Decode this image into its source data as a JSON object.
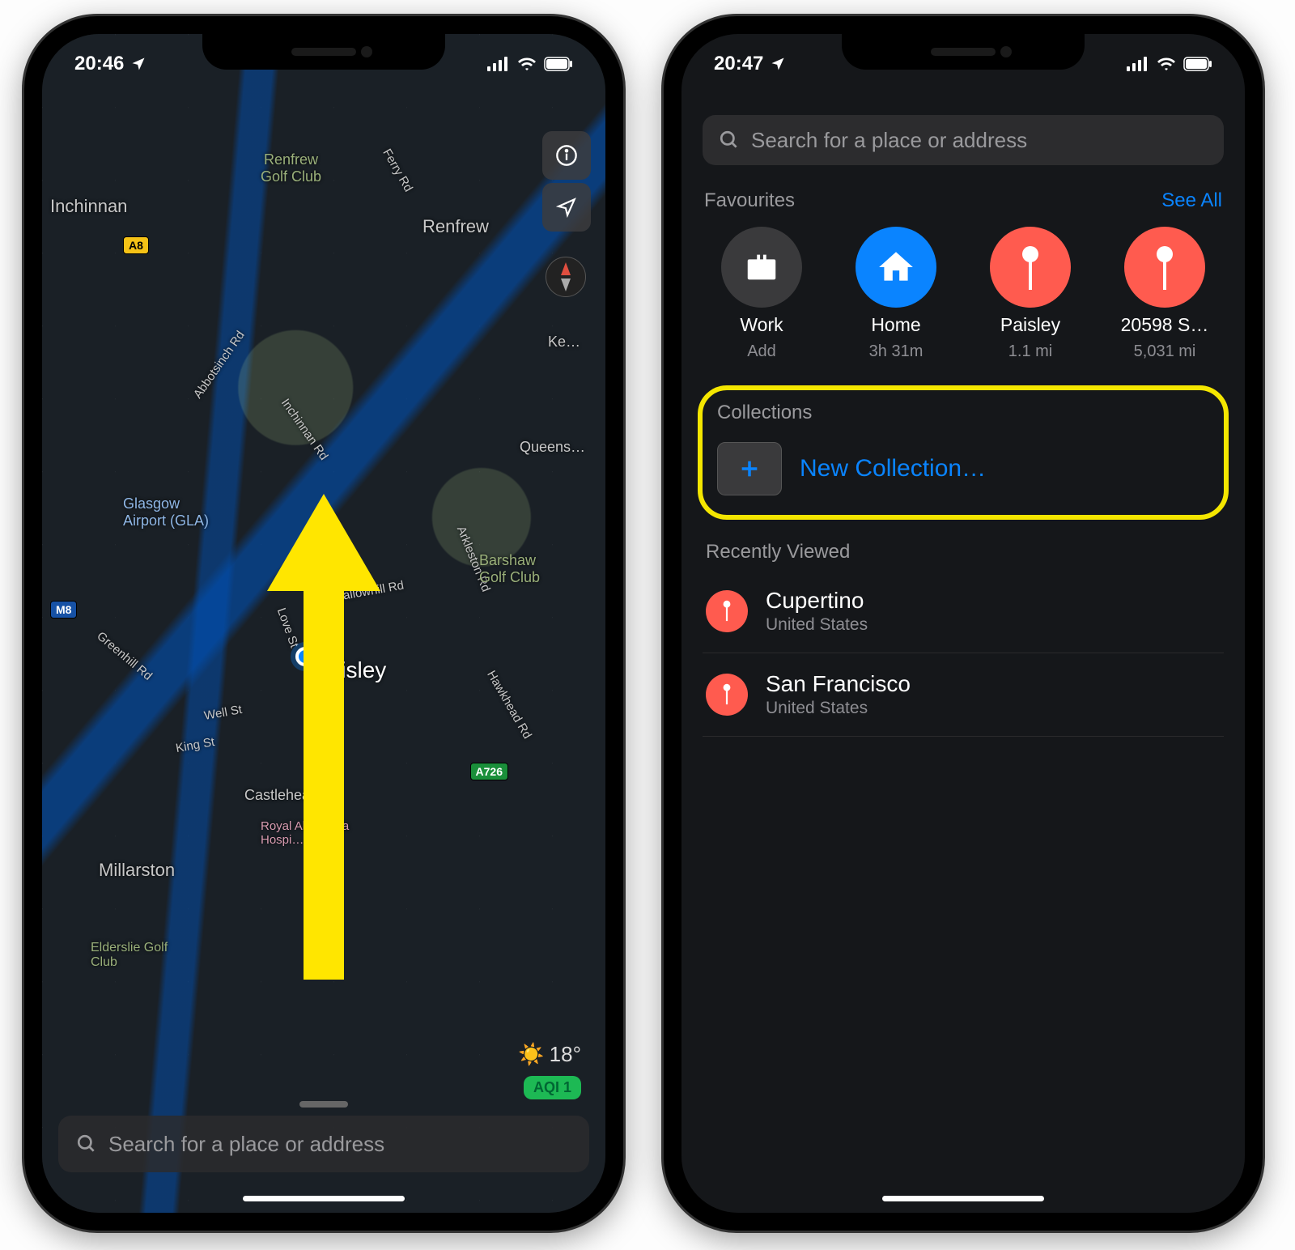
{
  "left": {
    "time": "20:46",
    "search_placeholder": "Search for a place or address",
    "weather_temp": "18°",
    "aqi": "AQI 1",
    "center_label": "Paisley",
    "roads": {
      "a8": "A8",
      "a726": "A726"
    },
    "labels": {
      "inchinnan": "Inchinnan",
      "renfrew_golf": "Renfrew\nGolf Club",
      "renfrew": "Renfrew",
      "ferry_rd": "Ferry Rd",
      "abbots": "Abbotsinch Rd",
      "glasgow_airport": "Glasgow\nAirport (GLA)",
      "gallowhill": "Gallowhill Rd",
      "arkleston": "Arkleston Rd",
      "barshaw": "Barshaw\nGolf Club",
      "love_st": "Love St",
      "greenhill": "Greenhill Rd",
      "well_st": "Well St",
      "king_st": "King St",
      "hawkhead": "Hawkhead Rd",
      "castlehead": "Castlehead",
      "hospital": "Royal Alexandra\nHospi…",
      "millarston": "Millarston",
      "elderslie": "Elderslie Golf\nClub",
      "queens": "Queens…",
      "ke": "Ke…",
      "m8": "M8",
      "inchinnan_rd": "Inchinnan Rd"
    }
  },
  "right": {
    "time": "20:47",
    "search_placeholder": "Search for a place or address",
    "favourites_title": "Favourites",
    "see_all": "See All",
    "favourites": [
      {
        "name": "Work",
        "sub": "Add",
        "color": "c-grey",
        "icon": "briefcase"
      },
      {
        "name": "Home",
        "sub": "3h 31m",
        "color": "c-blue",
        "icon": "house"
      },
      {
        "name": "Paisley",
        "sub": "1.1 mi",
        "color": "c-red",
        "icon": "pin"
      },
      {
        "name": "20598 S…",
        "sub": "5,031 mi",
        "color": "c-red",
        "icon": "pin"
      }
    ],
    "collections_title": "Collections",
    "new_collection": "New Collection…",
    "recent_title": "Recently Viewed",
    "recent": [
      {
        "title": "Cupertino",
        "sub": "United States"
      },
      {
        "title": "San Francisco",
        "sub": "United States"
      }
    ]
  }
}
